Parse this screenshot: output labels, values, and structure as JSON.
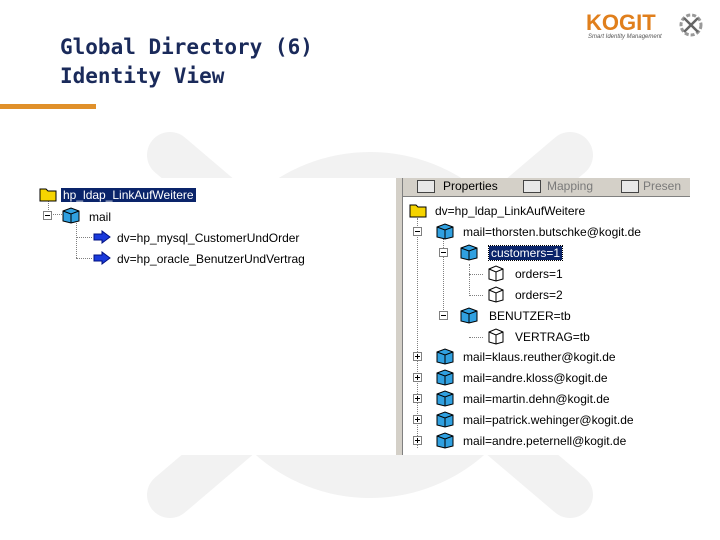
{
  "slide": {
    "title_line1": "Global Directory (6)",
    "title_line2": "Identity View"
  },
  "logo": {
    "brand": "KOGIT",
    "tagline": "Smart Identity Management"
  },
  "left_tree": {
    "root": "hp_ldap_LinkAufWeitere",
    "child": "mail",
    "links": [
      "dv=hp_mysql_CustomerUndOrder",
      "dv=hp_oracle_BenutzerUndVertrag"
    ]
  },
  "right_toolbar": {
    "properties": "Properties",
    "mapping": "Mapping",
    "presentation": "Presen"
  },
  "right_tree": {
    "root": "dv=hp_ldap_LinkAufWeitere",
    "mail1": "mail=thorsten.butschke@kogit.de",
    "customers": "customers=1",
    "orders1": "orders=1",
    "orders2": "orders=2",
    "benutzer": "BENUTZER=tb",
    "vertrag": "VERTRAG=tb",
    "mails": [
      "mail=klaus.reuther@kogit.de",
      "mail=andre.kloss@kogit.de",
      "mail=martin.dehn@kogit.de",
      "mail=patrick.wehinger@kogit.de",
      "mail=andre.peternell@kogit.de"
    ]
  },
  "colors": {
    "accent_orange": "#e0902a",
    "title_navy": "#1a2a5a",
    "selection_blue": "#0a246a"
  }
}
